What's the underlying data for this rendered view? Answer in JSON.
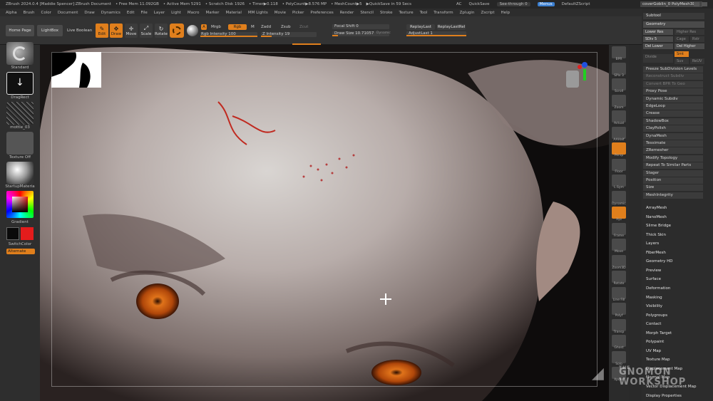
{
  "title_bar": {
    "app": "ZBrush 2024.0.4 [Maddie Spencer]:ZBrush Document",
    "free_mem": "• Free Mem 11.092GB",
    "active_mem": "• Active Mem 5291",
    "scratch": "• Scratch Disk 1926",
    "timer": "• Timer▶0.118",
    "polycount": "• PolyCount▶8.576 MP",
    "meshcount": "• MeshCount▶5",
    "quicksave_in": "▶QuickSave in 59 Secs",
    "ac": "AC",
    "quicksave": "QuickSave",
    "see_through": "See-through 0",
    "menus": "Menus",
    "default_zscript": "DefaultZScript",
    "tool_name": "coverGoblin_0 PolyMesh3D_1"
  },
  "menu": [
    "Alpha",
    "Brush",
    "Color",
    "Document",
    "Draw",
    "Dynamics",
    "Edit",
    "File",
    "Layer",
    "Light",
    "Macro",
    "Marker",
    "Material",
    "MM Lights",
    "Movie",
    "Picker",
    "Preferences",
    "Render",
    "Stencil",
    "Stroke",
    "Texture",
    "Tool",
    "Transform",
    "Zplugin",
    "Zscript",
    "Help"
  ],
  "shelf": {
    "home_page": "Home Page",
    "lightbox": "LightBox",
    "live_boolean": "Live Boolean",
    "edit": "Edit",
    "draw": "Draw",
    "move": "Move",
    "scale": "Scale",
    "rotate": "Rotate",
    "a": "A",
    "mrgb": "Mrgb",
    "rgb": "Rgb",
    "m": "M",
    "zadd": "Zadd",
    "zsub": "Zsub",
    "zcut": "Zcut",
    "rgb_intensity": "Rgb Intensity 100",
    "z_intensity": "Z Intensity 19",
    "focal_shift": "Focal Shift 0",
    "draw_size": "Draw Size 10.71057",
    "dynamic": "Dynamic",
    "replay_last": "ReplayLast",
    "replay_last_rel": "ReplayLastRel",
    "adjust_last": "AdjustLast 1"
  },
  "left_tray": {
    "standard": "Standard",
    "dragrect": "DragRect",
    "mottle": "mottle_03",
    "texture_off": "Texture Off",
    "startup_material": "StartupMateria",
    "gradient": "Gradient",
    "switch_color": "SwitchColor",
    "alternate": "Alternate"
  },
  "right_dock": [
    "BPR",
    "SPix 3",
    "Scroll",
    "Zoom",
    "Actual",
    "AAHalf",
    "Persp",
    "Floor",
    "L.Sym",
    "Dynamic",
    "Xyz",
    "Frame",
    "Move",
    "Zoom3D",
    "Rotate",
    "Line Fill",
    "Polyf",
    "Transp",
    "Ghost",
    "Solo",
    "Xpose"
  ],
  "palette": {
    "subtool": "Subtool",
    "geometry": "Geometry",
    "lower_res": "Lower Res",
    "higher_res": "Higher Res",
    "sdiv": "SDiv 5",
    "cage": "Cage",
    "rstr": "Rstr",
    "del_lower": "Del Lower",
    "del_higher": "Del Higher",
    "divide": "Divide",
    "smt": "Smt",
    "suv": "Suv",
    "reuv": "ReUV",
    "rows": [
      "Freeze SubDivision Levels",
      "Reconstruct Subdiv",
      "Convert BPR To Geo",
      "Proxy Pose",
      "Dynamic Subdiv",
      "EdgeLoop",
      "Crease",
      "ShadowBox",
      "ClayPolish",
      "DynaMesh",
      "Tessimate",
      "ZRemesher",
      "Modify Topology",
      "Repeat To Similar Parts",
      "Stager",
      "Position",
      "Size",
      "MeshIntegrity"
    ],
    "menus": [
      "ArrayMesh",
      "NanoMesh",
      "Slime Bridge",
      "Thick Skin",
      "Layers",
      "FiberMesh",
      "Geometry HD",
      "Preview",
      "Surface",
      "Deformation",
      "Masking",
      "Visibility",
      "Polygroups",
      "Contact",
      "Morph Target",
      "Polypaint",
      "UV Map",
      "Texture Map",
      "Displacement Map",
      "Normal Map",
      "Vector Displacement Map",
      "Display Properties"
    ]
  },
  "watermark": [
    "THE",
    "GNOMON",
    "WORKSHOP"
  ],
  "colors": {
    "accent": "#e07f1c",
    "primary_color": "#0a0a0a",
    "secondary_color": "#e41c1c"
  },
  "icons": {
    "cursor": "crosshair-cursor-icon",
    "gizmo": "xyz-gizmo-icon"
  }
}
